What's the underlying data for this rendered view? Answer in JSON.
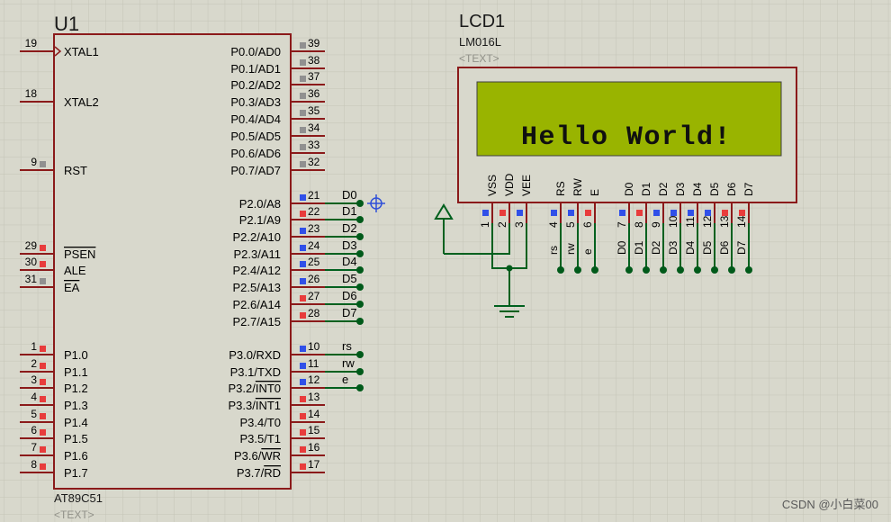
{
  "u1": {
    "ref": "U1",
    "part": "AT89C51",
    "text_placeholder": "<TEXT>",
    "left_pins": [
      {
        "num": "19",
        "name": "XTAL1",
        "clock": true
      },
      {
        "num": "18",
        "name": "XTAL2"
      },
      {
        "num": "9",
        "name": "RST",
        "marker": "gray"
      },
      {
        "num": "29",
        "name": "PSEN",
        "overline": true,
        "marker": "red"
      },
      {
        "num": "30",
        "name": "ALE",
        "marker": "red"
      },
      {
        "num": "31",
        "name": "EA",
        "overline": true,
        "marker": "gray"
      },
      {
        "num": "1",
        "name": "P1.0",
        "marker": "red"
      },
      {
        "num": "2",
        "name": "P1.1",
        "marker": "red"
      },
      {
        "num": "3",
        "name": "P1.2",
        "marker": "red"
      },
      {
        "num": "4",
        "name": "P1.3",
        "marker": "red"
      },
      {
        "num": "5",
        "name": "P1.4",
        "marker": "red"
      },
      {
        "num": "6",
        "name": "P1.5",
        "marker": "red"
      },
      {
        "num": "7",
        "name": "P1.6",
        "marker": "red"
      },
      {
        "num": "8",
        "name": "P1.7",
        "marker": "red"
      }
    ],
    "right_pins": [
      {
        "num": "39",
        "name": "P0.0/AD0",
        "marker": "gray"
      },
      {
        "num": "38",
        "name": "P0.1/AD1",
        "marker": "gray"
      },
      {
        "num": "37",
        "name": "P0.2/AD2",
        "marker": "gray"
      },
      {
        "num": "36",
        "name": "P0.3/AD3",
        "marker": "gray"
      },
      {
        "num": "35",
        "name": "P0.4/AD4",
        "marker": "gray"
      },
      {
        "num": "34",
        "name": "P0.5/AD5",
        "marker": "gray"
      },
      {
        "num": "33",
        "name": "P0.6/AD6",
        "marker": "gray"
      },
      {
        "num": "32",
        "name": "P0.7/AD7",
        "marker": "gray"
      },
      {
        "num": "21",
        "name": "P2.0/A8",
        "marker": "blue",
        "net": "D0"
      },
      {
        "num": "22",
        "name": "P2.1/A9",
        "marker": "red",
        "net": "D1"
      },
      {
        "num": "23",
        "name": "P2.2/A10",
        "marker": "blue",
        "net": "D2"
      },
      {
        "num": "24",
        "name": "P2.3/A11",
        "marker": "blue",
        "net": "D3"
      },
      {
        "num": "25",
        "name": "P2.4/A12",
        "marker": "blue",
        "net": "D4"
      },
      {
        "num": "26",
        "name": "P2.5/A13",
        "marker": "blue",
        "net": "D5"
      },
      {
        "num": "27",
        "name": "P2.6/A14",
        "marker": "red",
        "net": "D6"
      },
      {
        "num": "28",
        "name": "P2.7/A15",
        "marker": "red",
        "net": "D7"
      },
      {
        "num": "10",
        "name": "P3.0/RXD",
        "marker": "blue",
        "net": "rs"
      },
      {
        "num": "11",
        "name": "P3.1/TXD",
        "marker": "blue",
        "net": "rw"
      },
      {
        "num": "12",
        "name": "P3.2/INT0",
        "marker": "blue",
        "net": "e",
        "overline_from": 5
      },
      {
        "num": "13",
        "name": "P3.3/INT1",
        "marker": "red",
        "overline_from": 5
      },
      {
        "num": "14",
        "name": "P3.4/T0",
        "marker": "red"
      },
      {
        "num": "15",
        "name": "P3.5/T1",
        "marker": "red"
      },
      {
        "num": "16",
        "name": "P3.6/WR",
        "marker": "red",
        "overline_from": 5
      },
      {
        "num": "17",
        "name": "P3.7/RD",
        "marker": "red",
        "overline_from": 5
      }
    ]
  },
  "lcd": {
    "ref": "LCD1",
    "part": "LM016L",
    "text_placeholder": "<TEXT>",
    "display_text": "Hello World!",
    "screen_color": "#99b400",
    "pins": [
      {
        "num": "1",
        "name": "VSS",
        "marker": "blue"
      },
      {
        "num": "2",
        "name": "VDD",
        "marker": "red"
      },
      {
        "num": "3",
        "name": "VEE",
        "marker": "blue"
      },
      {
        "num": "4",
        "name": "RS",
        "marker": "blue",
        "net": "rs"
      },
      {
        "num": "5",
        "name": "RW",
        "marker": "blue",
        "net": "rw"
      },
      {
        "num": "6",
        "name": "E",
        "marker": "red",
        "net": "e"
      },
      {
        "num": "7",
        "name": "D0",
        "marker": "blue",
        "net": "D0"
      },
      {
        "num": "8",
        "name": "D1",
        "marker": "red",
        "net": "D1"
      },
      {
        "num": "9",
        "name": "D2",
        "marker": "blue",
        "net": "D2"
      },
      {
        "num": "10",
        "name": "D3",
        "marker": "blue",
        "net": "D3"
      },
      {
        "num": "11",
        "name": "D4",
        "marker": "blue",
        "net": "D4"
      },
      {
        "num": "12",
        "name": "D5",
        "marker": "blue",
        "net": "D5"
      },
      {
        "num": "13",
        "name": "D6",
        "marker": "red",
        "net": "D6"
      },
      {
        "num": "14",
        "name": "D7",
        "marker": "red",
        "net": "D7"
      }
    ]
  },
  "watermark": "CSDN @小白菜00",
  "colors": {
    "background": "#d8d8cc",
    "grid": "#c4c4b6",
    "component_body": "#d8d8cc",
    "component_outline": "#8b1a1a",
    "pin_line": "#8b1a1a",
    "wire": "#00601e",
    "junction": "#005a1a",
    "text": "#000000",
    "ref_text": "#1a1a1a",
    "placeholder_text": "#909088",
    "marker_red": "#e83c3c",
    "marker_blue": "#3050e8",
    "marker_gray": "#909090",
    "cursor": "#3050d8"
  },
  "icons": [
    "clock-input-icon",
    "power-arrow-icon",
    "ground-icon",
    "crosshair-cursor-icon"
  ]
}
